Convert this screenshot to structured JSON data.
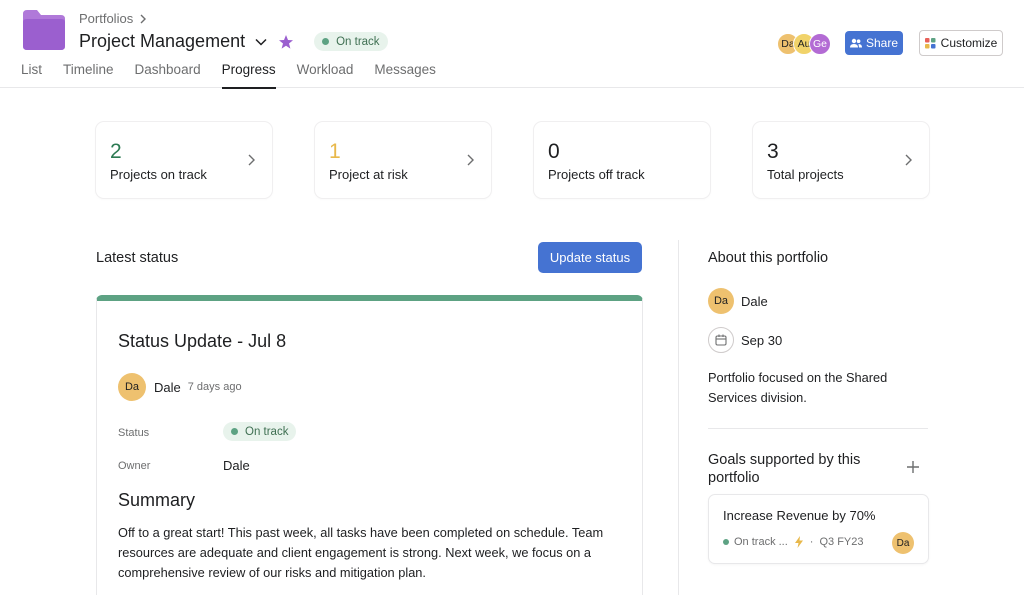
{
  "header": {
    "breadcrumb": "Portfolios",
    "title": "Project Management",
    "status_pill": "On track",
    "tabs": [
      "List",
      "Timeline",
      "Dashboard",
      "Progress",
      "Workload",
      "Messages"
    ],
    "active_tab": "Progress",
    "members": [
      {
        "initials": "Da",
        "color": "#eec16f"
      },
      {
        "initials": "Au",
        "color": "#f1d36a"
      },
      {
        "initials": "Ge",
        "color": "#b36bd4"
      }
    ],
    "share_label": "Share",
    "customize_label": "Customize"
  },
  "stats": [
    {
      "value": "2",
      "label": "Projects on track",
      "color": "#2c7a52"
    },
    {
      "value": "1",
      "label": "Project at risk",
      "color": "#e8b84a"
    },
    {
      "value": "0",
      "label": "Projects off track",
      "color": "#1e1f21"
    },
    {
      "value": "3",
      "label": "Total projects",
      "color": "#1e1f21"
    }
  ],
  "latest": {
    "heading": "Latest status",
    "update_button": "Update status",
    "card": {
      "title": "Status Update - Jul 8",
      "author_initials": "Da",
      "author": "Dale",
      "time": "7 days ago",
      "status_label": "Status",
      "status_value": "On track",
      "owner_label": "Owner",
      "owner_value": "Dale",
      "summary_title": "Summary",
      "summary_text": "Off to a great start! This past week, all tasks have been completed on schedule. Team resources are adequate and client engagement is strong. Next week, we focus on a comprehensive review of our risks and mitigation plan."
    }
  },
  "about": {
    "heading": "About this portfolio",
    "owner_initials": "Da",
    "owner": "Dale",
    "date": "Sep 30",
    "description": "Portfolio focused on the Shared Services division.",
    "goals_heading": "Goals supported by this portfolio",
    "goal": {
      "name": "Increase Revenue by 70%",
      "status": "On track ...",
      "period": "Q3 FY23",
      "owner_initials": "Da"
    }
  },
  "colors": {
    "accent": "#4573d2",
    "on_track": "#5da283",
    "folder": "#a66ad4"
  }
}
